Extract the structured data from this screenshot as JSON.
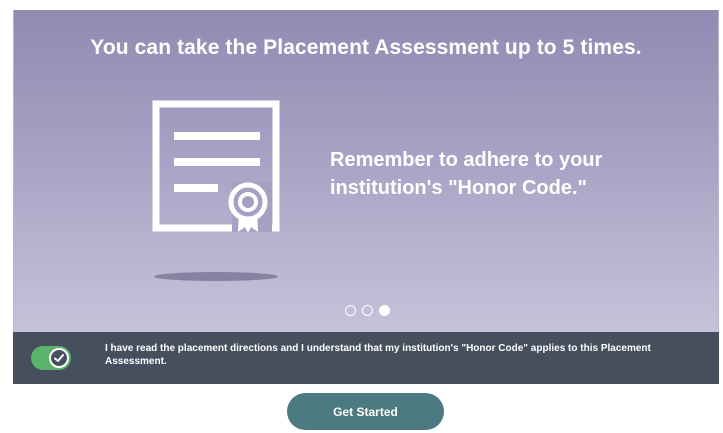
{
  "slide": {
    "title": "You can take the Placement Assessment up to 5 times.",
    "message_line1": "Remember to adhere to your",
    "message_line2": "institution's \"Honor Code.\"",
    "icon": "certificate-icon",
    "carousel": {
      "total": 3,
      "active_index": 3
    }
  },
  "agreement": {
    "checked": true,
    "toggle_icon": "checkmark-icon",
    "text": "I have read the placement directions and I understand that my institution's \"Honor Code\" applies to this Placement Assessment."
  },
  "actions": {
    "start_label": "Get Started"
  },
  "colors": {
    "slide_gradient_top": "#8f8bb2",
    "slide_gradient_bottom": "#c6c2da",
    "agree_bar": "#454f5e",
    "toggle_on": "#59b36a",
    "button": "#4d7a80"
  }
}
